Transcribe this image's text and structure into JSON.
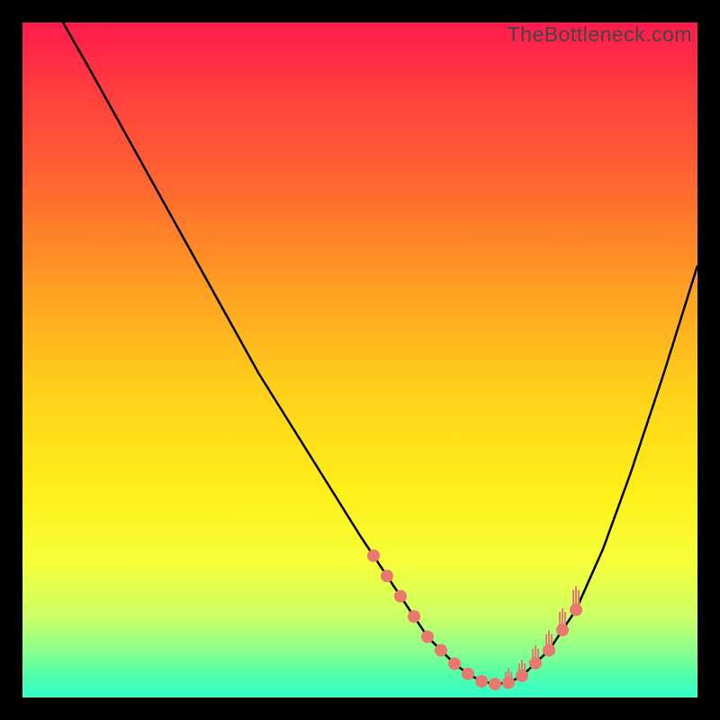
{
  "watermark": "TheBottleneck.com",
  "colors": {
    "bg": "#000000",
    "curve": "#000000",
    "marker": "#e7796f",
    "gradient_top": "#ff1a4d",
    "gradient_bottom": "#33ffcc"
  },
  "chart_data": {
    "type": "line",
    "title": "",
    "xlabel": "",
    "ylabel": "",
    "xlim": [
      0,
      100
    ],
    "ylim": [
      0,
      100
    ],
    "series": [
      {
        "name": "curve",
        "x": [
          6,
          10,
          15,
          20,
          25,
          30,
          35,
          40,
          45,
          50,
          52,
          54,
          56,
          58,
          60,
          62,
          64,
          66,
          68,
          70,
          72,
          74,
          78,
          82,
          86,
          90,
          95,
          100
        ],
        "y": [
          100,
          93,
          84,
          75,
          66,
          57,
          48,
          40,
          32,
          24,
          21,
          18,
          15,
          12,
          9,
          7,
          5,
          3.5,
          2.4,
          2,
          2.2,
          3.2,
          7,
          13,
          22,
          33,
          48,
          64
        ]
      }
    ],
    "markers_left": [
      52,
      54,
      56,
      58,
      60,
      62,
      64,
      66,
      68,
      70
    ],
    "markers_right": [
      72,
      74,
      76,
      78,
      80,
      82
    ],
    "markers_right_have_ticks": true
  }
}
